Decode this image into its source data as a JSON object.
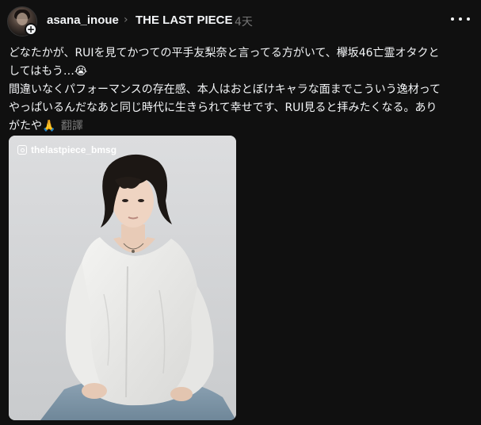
{
  "header": {
    "username": "asana_inoue",
    "separator_icon": "chevron-right-icon",
    "community": "THE LAST PIECE",
    "timestamp": "4天",
    "more_icon": "more-horizontal-icon",
    "follow_icon": "plus-icon"
  },
  "post": {
    "lines": [
      "どなたかが、RUIを見てかつての平手友梨奈と言ってる方がいて、欅坂46亡霊オタクと",
      "してはもう…😭",
      "間違いなくパフォーマンスの存在感、本人はおとぼけキャラな面までこういう逸材って",
      "やっぱいるんだなあと同じ時代に生きられて幸せです、RUI見ると拝みたくなる。あり",
      "がたや🙏"
    ],
    "translate_label": "翻譯"
  },
  "media": {
    "watermark": "thelastpiece_bmsg",
    "watermark_icon": "instagram-icon",
    "description": "photo"
  },
  "colors": {
    "background": "#101010",
    "text_primary": "#f3f5f7",
    "text_secondary": "#777777"
  }
}
